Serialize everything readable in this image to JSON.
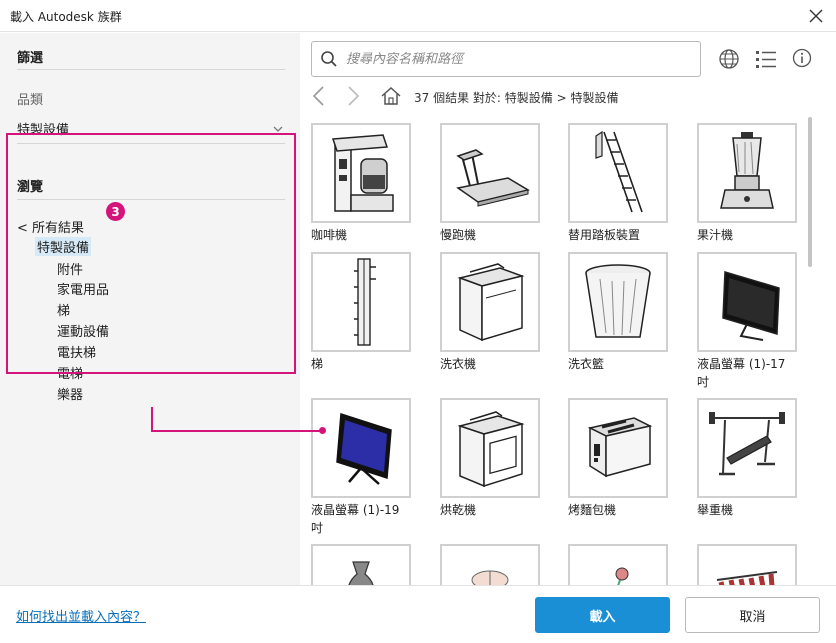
{
  "window": {
    "title": "載入 Autodesk 族群"
  },
  "filter": {
    "title": "篩選",
    "category_label": "品類",
    "category_value": "特製設備"
  },
  "browse": {
    "title": "瀏覽",
    "back_item": "< 所有結果",
    "selected_item": "特製設備",
    "badge": "3",
    "children": [
      "附件",
      "家電用品",
      "梯",
      "運動設備",
      "電扶梯",
      "電梯",
      "樂器"
    ]
  },
  "search": {
    "placeholder": "搜尋內容名稱和路徑",
    "value": ""
  },
  "breadcrumb": {
    "text": "37 個結果  對於: 特製設備 > 特製設備"
  },
  "items": [
    {
      "label": "咖啡機",
      "icon": "coffee-machine-icon"
    },
    {
      "label": "慢跑機",
      "icon": "treadmill-icon"
    },
    {
      "label": "替用踏板裝置",
      "icon": "ladder-icon"
    },
    {
      "label": "果汁機",
      "icon": "blender-icon"
    },
    {
      "label": "梯",
      "icon": "wall-ladder-icon"
    },
    {
      "label": "洗衣機",
      "icon": "washing-machine-icon"
    },
    {
      "label": "洗衣籃",
      "icon": "laundry-basket-icon"
    },
    {
      "label": "液晶螢幕 (1)-17 吋",
      "icon": "monitor-17-icon"
    },
    {
      "label": "液晶螢幕 (1)-19 吋",
      "icon": "monitor-19-icon"
    },
    {
      "label": "烘乾機",
      "icon": "dryer-icon"
    },
    {
      "label": "烤麵包機",
      "icon": "toaster-icon"
    },
    {
      "label": "舉重機",
      "icon": "weight-bench-icon"
    },
    {
      "label": "",
      "icon": "vase-icon"
    },
    {
      "label": "",
      "icon": "umbrella-icon"
    },
    {
      "label": "",
      "icon": "plant-icon"
    },
    {
      "label": "",
      "icon": "clothes-rack-icon"
    }
  ],
  "footer": {
    "help_link": "如何找出並載入內容？",
    "load_button": "載入",
    "cancel_button": "取消"
  },
  "colors": {
    "accent": "#d4147a",
    "primary": "#1a8fd6",
    "selection": "#d6e9f7"
  }
}
